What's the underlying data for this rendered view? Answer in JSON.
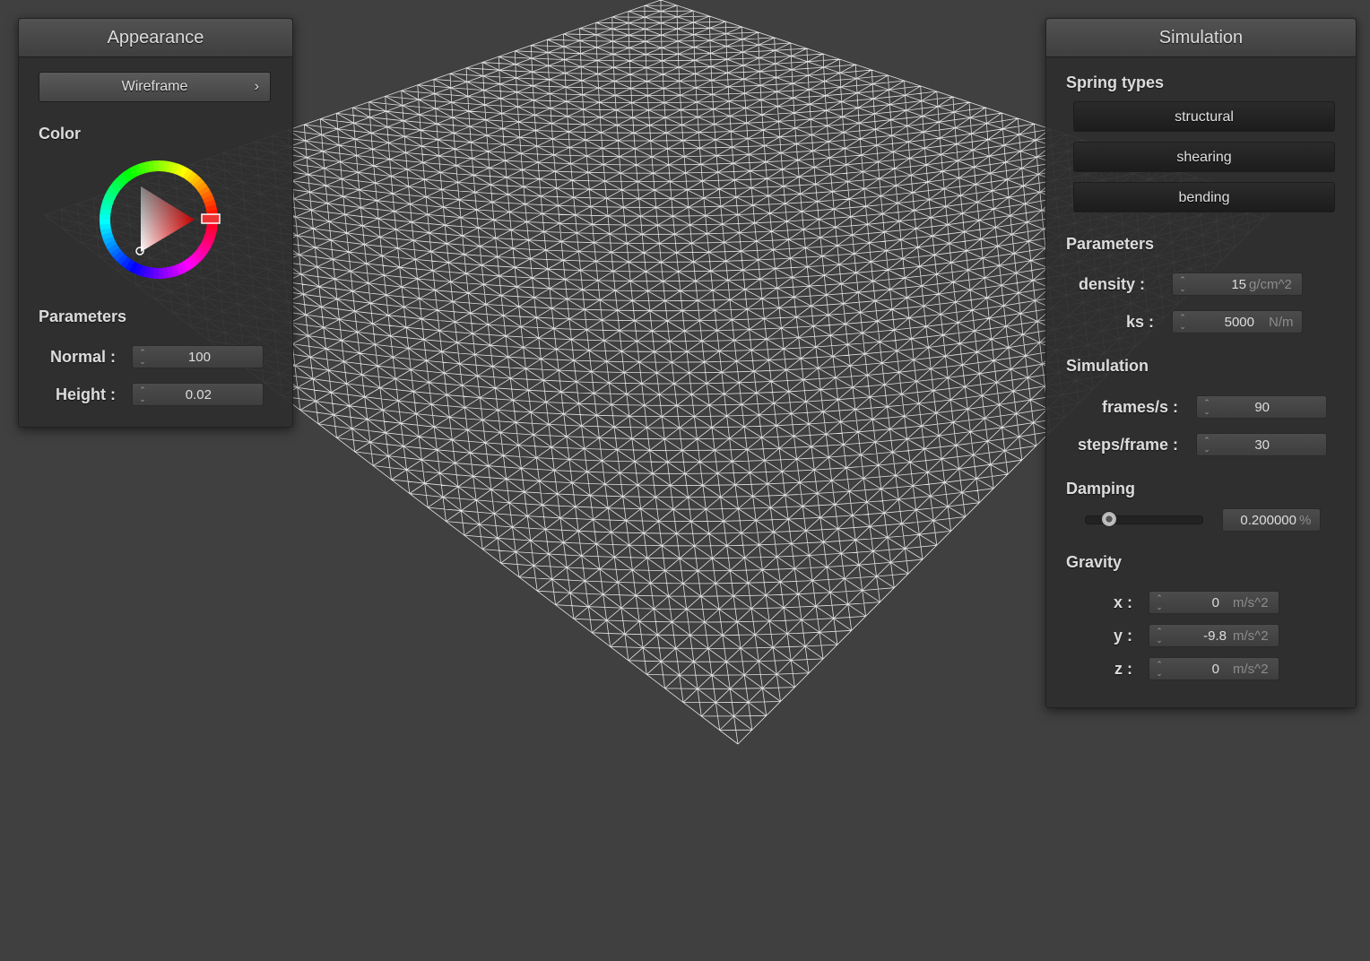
{
  "appearance": {
    "title": "Appearance",
    "shader_button": "Wireframe",
    "color_label": "Color",
    "parameters_label": "Parameters",
    "normal_label": "Normal :",
    "normal_value": "100",
    "height_label": "Height :",
    "height_value": "0.02",
    "selected_color": "#ff0000"
  },
  "simulation": {
    "title": "Simulation",
    "spring_types_label": "Spring types",
    "springs": [
      "structural",
      "shearing",
      "bending"
    ],
    "parameters_label": "Parameters",
    "density_label": "density :",
    "density_value": "15",
    "density_unit": "g/cm^2",
    "ks_label": "ks :",
    "ks_value": "5000",
    "ks_unit": "N/m",
    "simulation_label": "Simulation",
    "fps_label": "frames/s :",
    "fps_value": "90",
    "steps_label": "steps/frame :",
    "steps_value": "30",
    "damping_label": "Damping",
    "damping_value": "0.200000",
    "damping_unit": "%",
    "damping_fraction": 0.2,
    "gravity_label": "Gravity",
    "gx_label": "x :",
    "gx_value": "0",
    "gy_label": "y :",
    "gy_value": "-9.8",
    "gz_label": "z :",
    "gz_value": "0",
    "gravity_unit": "m/s^2"
  },
  "viewport": {
    "mesh_color": "#ffffff",
    "background": "#404040"
  }
}
